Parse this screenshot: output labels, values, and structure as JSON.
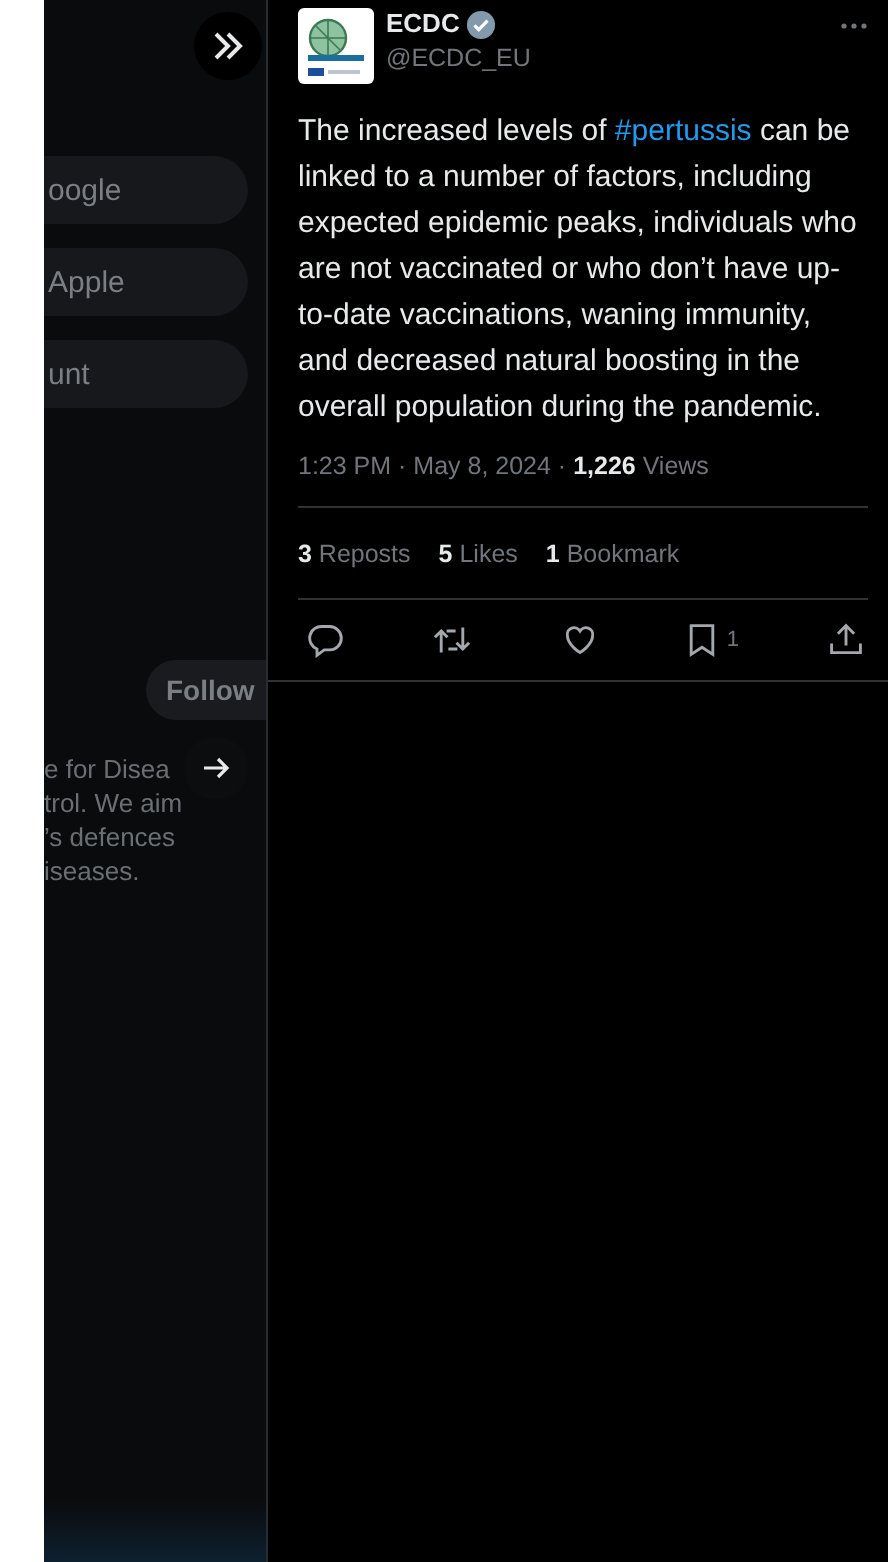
{
  "sidebar": {
    "login_buttons": [
      "oogle",
      "Apple",
      "unt"
    ],
    "follow_button": "Follow",
    "bio_lines": [
      "e for Disea",
      "trol. We aim",
      "’s defences",
      "iseases."
    ]
  },
  "tweet": {
    "name": "ECDC",
    "verified": true,
    "handle": "@ECDC_EU",
    "hashtag": "#pertussis",
    "text_before": "The increased levels of ",
    "text_after": " can be linked to a number of factors, including expected epidemic peaks, individuals who are not vaccinated or who don’t have up-to-date vaccinations, waning immunity, and decreased natural boosting in the overall population during the pandemic.",
    "time": "1:23 PM · May 8, 2024 · ",
    "views_count": "1,226",
    "views_label": "Views",
    "stats": [
      {
        "count": "3",
        "label": "Reposts"
      },
      {
        "count": "5",
        "label": "Likes"
      },
      {
        "count": "1",
        "label": "Bookmark"
      }
    ],
    "actions": [
      {
        "kind": "reply"
      },
      {
        "kind": "repost"
      },
      {
        "kind": "like"
      },
      {
        "kind": "bookmark",
        "count": "1"
      },
      {
        "kind": "share"
      }
    ]
  }
}
